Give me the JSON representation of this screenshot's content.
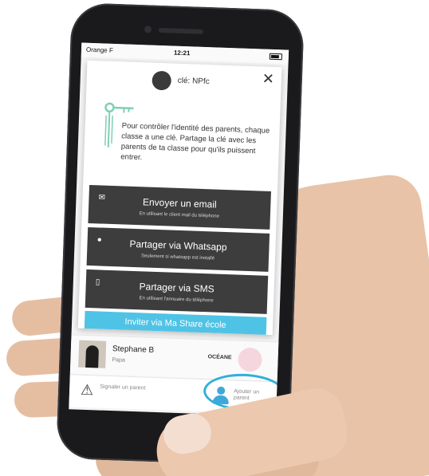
{
  "status_bar": {
    "carrier": "Orange F",
    "time": "12:21"
  },
  "modal": {
    "key_label": "clé: NPfc",
    "close_symbol": "✕",
    "description": "Pour contrôler l'identité des parents, chaque classe a une clé. Partage la clé avec les parents de ta classe pour qu'ils puissent entrer.",
    "actions": [
      {
        "icon": "email-icon",
        "title": "Envoyer un email",
        "subtitle": "En utilisant le client mail du téléphone"
      },
      {
        "icon": "chat-icon",
        "title": "Partager via Whatsapp",
        "subtitle": "Seulement si whatsapp est installé"
      },
      {
        "icon": "phone-book-icon",
        "title": "Partager via SMS",
        "subtitle": "En utilisant l'annuaire du téléphone"
      }
    ],
    "invite_label": "Inviter via Ma Share école"
  },
  "parent": {
    "name": "Stephane B",
    "role": "Papa",
    "child": "OCÉANE"
  },
  "bottom_bar": {
    "report_label": "Signaler un parent",
    "add_label": "Ajouter un parent"
  },
  "colors": {
    "accent": "#4fc3e6",
    "highlight": "#2fb0d8",
    "action_bg": "#3d3d3d",
    "key_green": "#7fcfb8"
  }
}
